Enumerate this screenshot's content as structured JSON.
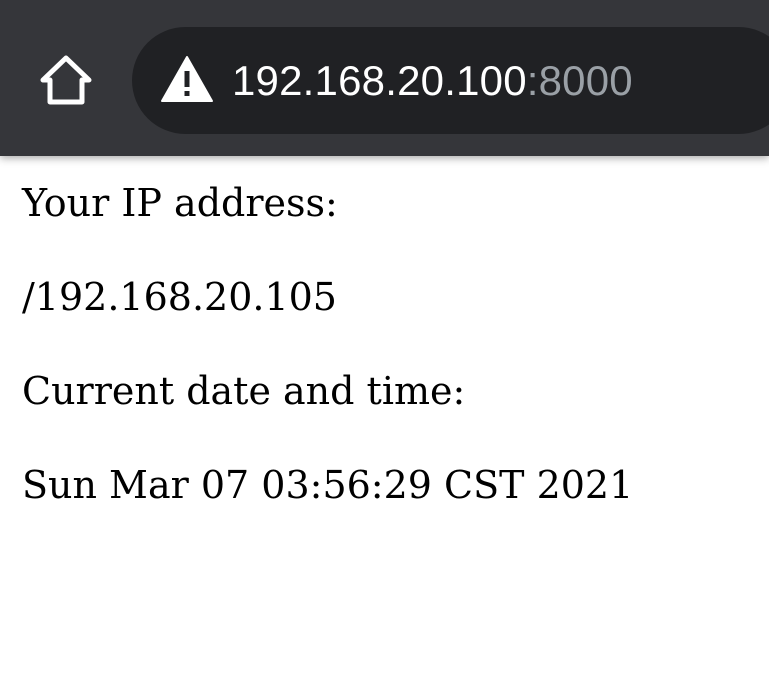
{
  "browser": {
    "toolbar_color": "#35363a",
    "omnibox_color": "#202124",
    "home_icon": "home-icon",
    "security_icon": "warning-triangle-icon",
    "url": {
      "host": "192.168.20.100",
      "port": ":8000"
    }
  },
  "page": {
    "lines": [
      "Your IP address:",
      "/192.168.20.105",
      "Current date and time:",
      "Sun Mar 07 03:56:29 CST 2021"
    ]
  }
}
